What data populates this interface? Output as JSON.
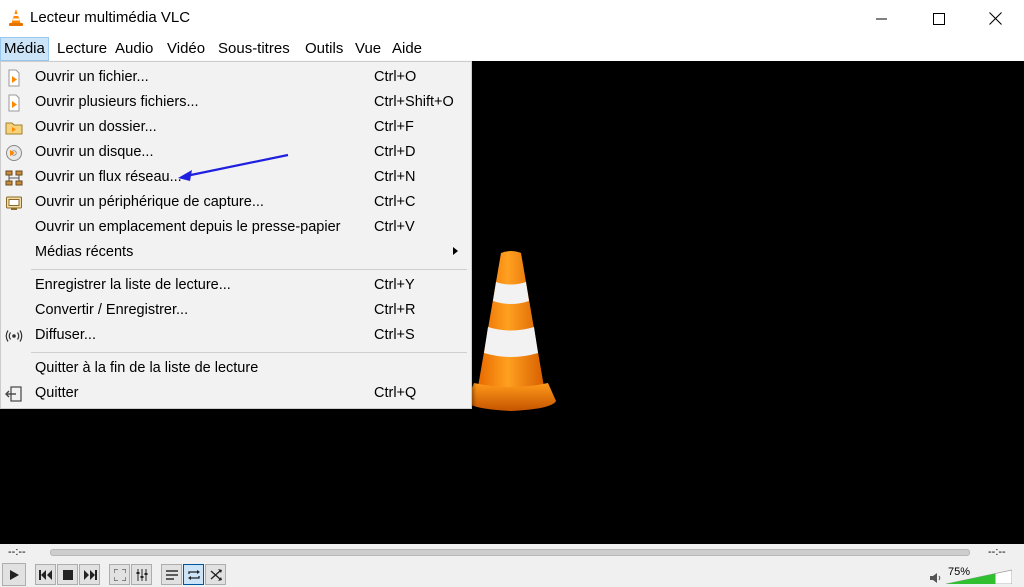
{
  "window": {
    "title": "Lecteur multimédia VLC",
    "controls": [
      "minimize-icon",
      "maximize-icon",
      "close-icon"
    ]
  },
  "menubar": {
    "items": [
      {
        "label": "Média",
        "active": true
      },
      {
        "label": "Lecture"
      },
      {
        "label": "Audio"
      },
      {
        "label": "Vidéo"
      },
      {
        "label": "Sous-titres"
      },
      {
        "label": "Outils"
      },
      {
        "label": "Vue"
      },
      {
        "label": "Aide"
      }
    ]
  },
  "media_menu": {
    "items": [
      {
        "label": "Ouvrir un fichier...",
        "shortcut": "Ctrl+O",
        "icon": "file-open-icon"
      },
      {
        "label": "Ouvrir plusieurs fichiers...",
        "shortcut": "Ctrl+Shift+O",
        "icon": "files-open-icon"
      },
      {
        "label": "Ouvrir un dossier...",
        "shortcut": "Ctrl+F",
        "icon": "folder-icon"
      },
      {
        "label": "Ouvrir un disque...",
        "shortcut": "Ctrl+D",
        "icon": "disc-icon"
      },
      {
        "label": "Ouvrir un flux réseau...",
        "shortcut": "Ctrl+N",
        "icon": "network-icon"
      },
      {
        "label": "Ouvrir un périphérique de capture...",
        "shortcut": "Ctrl+C",
        "icon": "capture-device-icon"
      },
      {
        "label": "Ouvrir un emplacement depuis le presse-papier",
        "shortcut": "Ctrl+V",
        "icon": ""
      },
      {
        "label": "Médias récents",
        "shortcut": "",
        "icon": "",
        "submenu": true
      },
      {
        "label": "Enregistrer la liste de lecture...",
        "shortcut": "Ctrl+Y",
        "icon": ""
      },
      {
        "label": "Convertir / Enregistrer...",
        "shortcut": "Ctrl+R",
        "icon": ""
      },
      {
        "label": "Diffuser...",
        "shortcut": "Ctrl+S",
        "icon": "stream-icon"
      },
      {
        "label": "Quitter à la fin de la liste de lecture",
        "shortcut": "",
        "icon": ""
      },
      {
        "label": "Quitter",
        "shortcut": "Ctrl+Q",
        "icon": "quit-icon"
      }
    ]
  },
  "player": {
    "time_elapsed": "--:--",
    "time_total": "--:--",
    "volume_label": "75%",
    "volume_level": 0.75,
    "accent_color": "#ff8800"
  },
  "controls": {
    "buttons": [
      "play-icon",
      "previous-icon",
      "stop-icon",
      "next-icon",
      "fullscreen-icon",
      "extended-settings-icon",
      "playlist-icon",
      "loop-icon",
      "shuffle-icon"
    ]
  }
}
